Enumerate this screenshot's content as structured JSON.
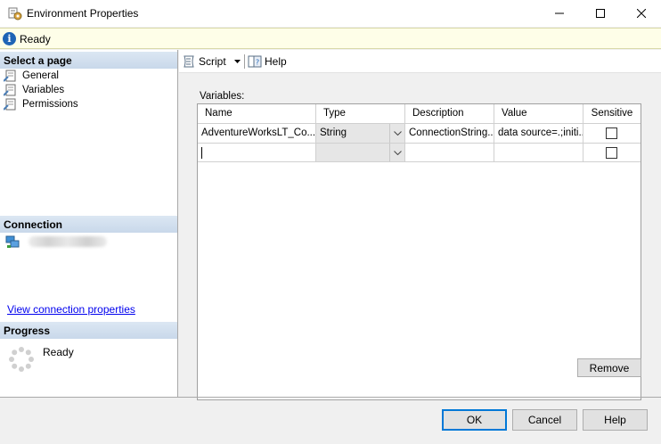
{
  "window": {
    "title": "Environment Properties",
    "minimize_glyph": "—",
    "maximize_glyph": "☐",
    "close_glyph": "✕"
  },
  "status": {
    "text": "Ready",
    "icon": "info-icon",
    "icon_glyph": "i"
  },
  "left_panel": {
    "select_page_header": "Select a page",
    "pages": [
      {
        "label": "General",
        "icon": "page-wrench-icon"
      },
      {
        "label": "Variables",
        "icon": "page-wrench-icon"
      },
      {
        "label": "Permissions",
        "icon": "page-wrench-icon"
      }
    ],
    "connection_header": "Connection",
    "connection_icon": "server-connection-icon",
    "view_connection_link": "View connection properties",
    "progress_header": "Progress",
    "progress_text": "Ready",
    "progress_icon": "spinner-icon"
  },
  "toolbar": {
    "script_label": "Script",
    "script_icon": "script-icon",
    "help_label": "Help",
    "help_icon": "help-icon"
  },
  "variables": {
    "label": "Variables:",
    "columns": [
      "Name",
      "Type",
      "Description",
      "Value",
      "Sensitive"
    ],
    "rows": [
      {
        "name": "AdventureWorksLT_Co...",
        "type": "String",
        "description": "ConnectionString...",
        "value": "data source=.;initi...",
        "sensitive": false
      },
      {
        "name": "",
        "type": "",
        "description": "",
        "value": "",
        "sensitive": false
      }
    ],
    "remove_label": "Remove"
  },
  "dialog_buttons": {
    "ok": "OK",
    "cancel": "Cancel",
    "help": "Help"
  },
  "colors": {
    "status_bg": "#fefee8",
    "section_header": "#d3e0ef",
    "link": "#0000ee",
    "ok_border": "#0078d7",
    "info_icon": "#1f64b5"
  }
}
